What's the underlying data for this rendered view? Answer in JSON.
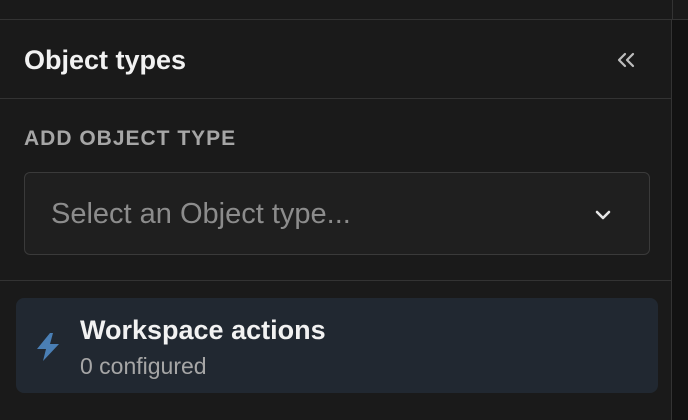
{
  "panel": {
    "title": "Object types",
    "collapse_icon": "double-chevron-left-icon"
  },
  "add_object_type": {
    "label": "ADD OBJECT TYPE",
    "select": {
      "placeholder": "Select an Object type...",
      "icon": "chevron-down-icon"
    }
  },
  "workspace_actions": {
    "title": "Workspace actions",
    "status": "0 configured",
    "icon": "lightning-bolt-icon",
    "icon_color": "#4a7fb5"
  }
}
